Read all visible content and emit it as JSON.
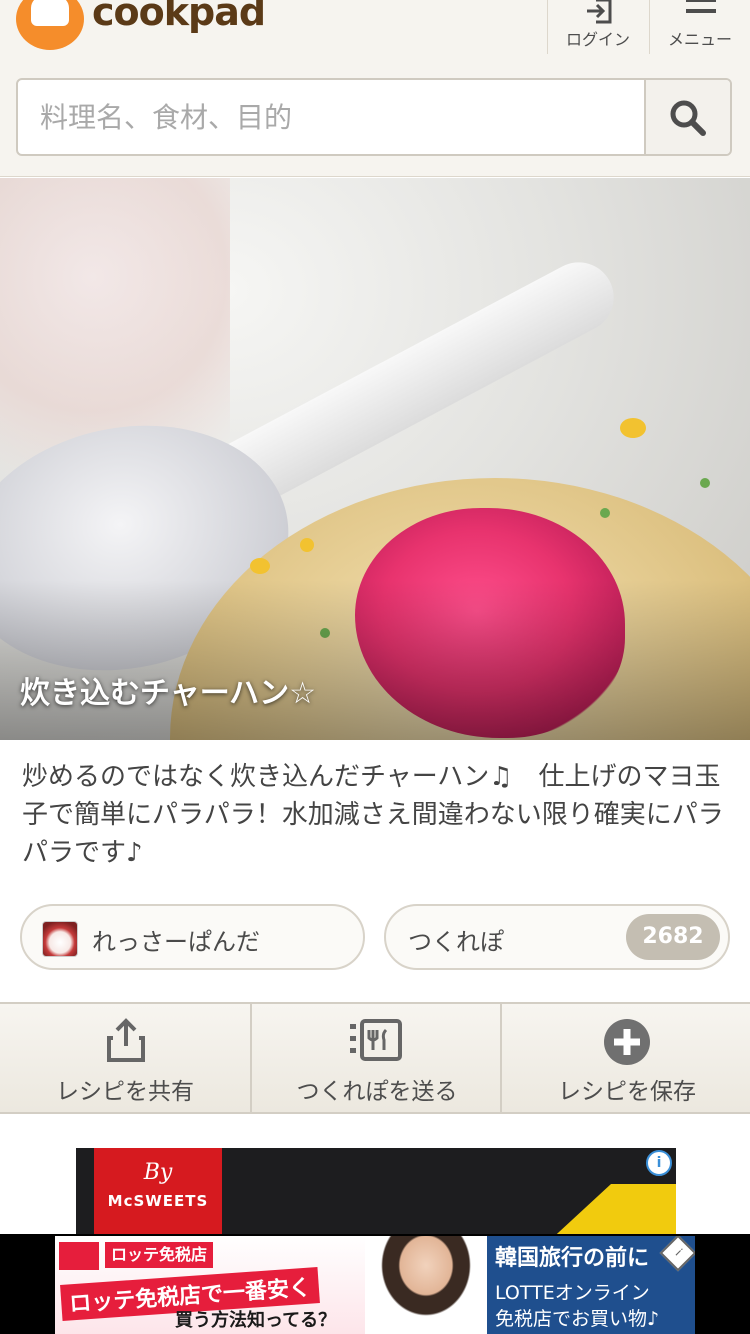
{
  "header": {
    "logo_text": "cookpad",
    "login_label": "ログイン",
    "menu_label": "メニュー"
  },
  "search": {
    "placeholder": "料理名、食材、目的"
  },
  "recipe": {
    "title": "炊き込むチャーハン☆",
    "description": "炒めるのではなく炊き込んだチャーハン♫　仕上げのマヨ玉子で簡単にパラパラ！水加減さえ間違わない限り確実にパラパラです♪",
    "author": "れっさーぱんだ",
    "tsukurepo_label": "つくれぽ",
    "tsukurepo_count": "2682"
  },
  "actions": {
    "share_label": "レシピを共有",
    "send_label": "つくれぽを送る",
    "save_label": "レシピを保存"
  },
  "ad1": {
    "by": "By",
    "brand": "McSWEETS"
  },
  "ad2": {
    "shop_small": "ロッテ免税店",
    "headline": "ロッテ免税店で一番安く",
    "subline": "買う方法知ってる？",
    "right_title": "韓国旅行の前に",
    "right_line1": "LOTTEオンライン",
    "right_line2": "免税店でお買い物♪"
  },
  "colors": {
    "brand_orange": "#f58d2b",
    "brand_brown": "#5b3a17",
    "count_badge": "#c4beb2",
    "lotte_red": "#e61e3c"
  },
  "icons": [
    "login-icon",
    "menu-icon",
    "search-icon",
    "share-icon",
    "send-report-icon",
    "add-icon",
    "ad-info-icon"
  ]
}
